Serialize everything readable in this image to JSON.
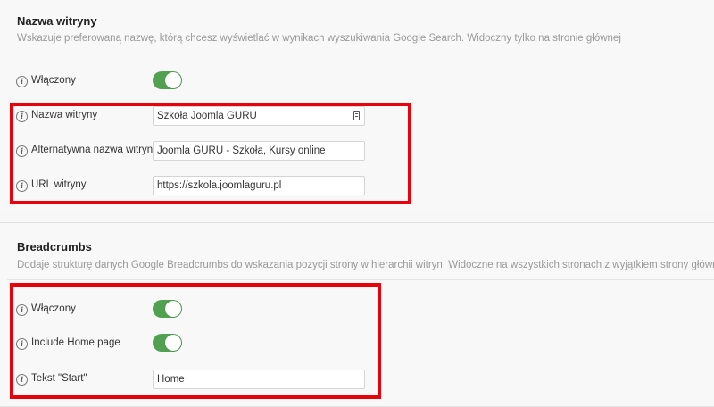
{
  "sections": [
    {
      "title": "Nazwa witryny",
      "description": "Wskazuje preferowaną nazwę, którą chcesz wyświetlać w wynikach wyszukiwania Google Search. Widoczny tylko na stronie głównej",
      "rows": [
        {
          "label": "Włączony",
          "type": "toggle",
          "enabled": true
        },
        {
          "label": "Nazwa witryny",
          "type": "input",
          "value": "Szkoła Joomla GURU",
          "icon": "contact-card-icon"
        },
        {
          "label": "Alternatywna nazwa witryny",
          "type": "input",
          "value": "Joomla GURU - Szkoła, Kursy online"
        },
        {
          "label": "URL witryny",
          "type": "input",
          "value": "https://szkola.joomlaguru.pl"
        }
      ]
    },
    {
      "title": "Breadcrumbs",
      "description": "Dodaje strukturę danych Google Breadcrumbs do wskazania pozycji strony w hierarchii witryn. Widoczne na wszystkich stronach z wyjątkiem strony głównej",
      "rows": [
        {
          "label": "Włączony",
          "type": "toggle",
          "enabled": true
        },
        {
          "label": "Include Home page",
          "type": "toggle",
          "enabled": true
        },
        {
          "label": "Tekst \"Start\"",
          "type": "input",
          "value": "Home"
        }
      ]
    }
  ],
  "info_icon_glyph": "i",
  "colors": {
    "toggle_on": "#52a151",
    "highlight": "#e8000b",
    "description": "#999999"
  }
}
